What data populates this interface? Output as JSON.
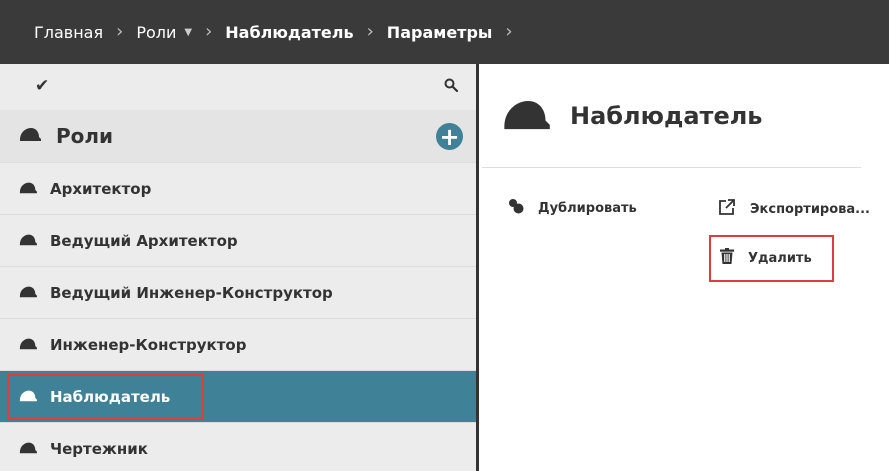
{
  "breadcrumb": {
    "items": [
      "Главная",
      "Роли",
      "Наблюдатель",
      "Параметры"
    ],
    "separator": "›"
  },
  "sidebar": {
    "header_title": "Роли",
    "add_label": "+",
    "items": [
      {
        "label": "Архитектор"
      },
      {
        "label": "Ведущий Архитектор"
      },
      {
        "label": "Ведущий Инженер-Конструктор"
      },
      {
        "label": "Инженер-Конструктор"
      },
      {
        "label": "Наблюдатель",
        "selected": true
      },
      {
        "label": "Чертежник"
      }
    ]
  },
  "main": {
    "title": "Наблюдатель",
    "actions": {
      "duplicate": "Дублировать",
      "export": "Экспортирова...",
      "delete": "Удалить"
    }
  },
  "colors": {
    "accent": "#3f8196",
    "topbar": "#3a3a3a",
    "highlight": "#e03c3c"
  },
  "icons": {
    "check": "check-icon",
    "search": "search-icon",
    "hat": "hard-hat-icon",
    "duplicate": "duplicate-icon",
    "export": "export-icon",
    "delete": "trash-icon"
  }
}
